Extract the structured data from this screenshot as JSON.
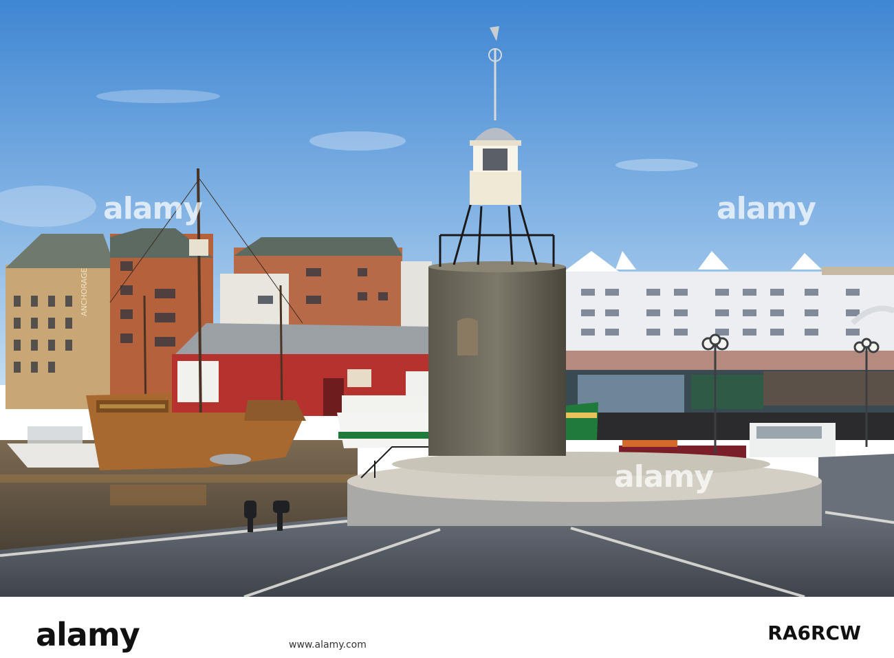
{
  "photo": {
    "subject": "harbour-scene",
    "sign_anchorage": "ANCHORAGE"
  },
  "watermarks": [
    "alamy",
    "alamy",
    "alamy"
  ],
  "footer": {
    "logo": "alamy",
    "image_id": "RA6RCW",
    "url": "www.alamy.com"
  },
  "colors": {
    "sky_top": "#4a8fd6",
    "sky_bottom": "#b9d6ee",
    "water": "#6b5a47",
    "pavement": "#4f5660",
    "tower_stone": "#6b6658",
    "red_shed": "#b5322f",
    "ship_hull": "#a7692f"
  }
}
